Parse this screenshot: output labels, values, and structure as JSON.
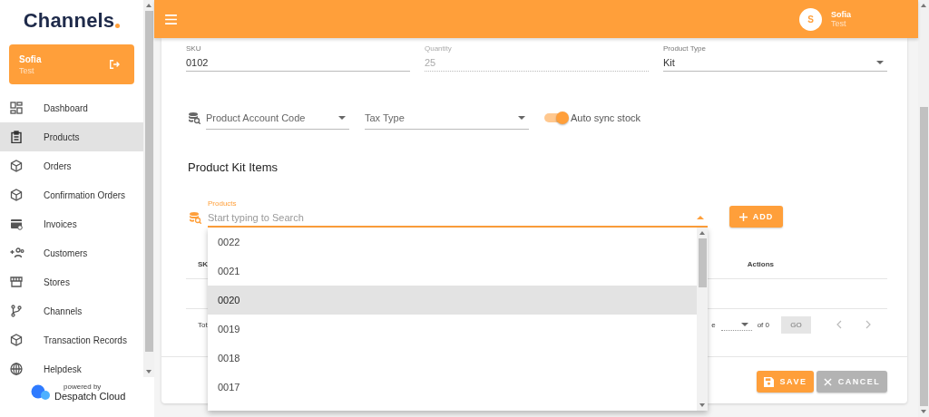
{
  "sidebar": {
    "logo": "Channels",
    "user": {
      "name": "Sofia",
      "role": "Test"
    },
    "items": [
      {
        "label": "Dashboard",
        "selected": false
      },
      {
        "label": "Products",
        "selected": true
      },
      {
        "label": "Orders",
        "selected": false
      },
      {
        "label": "Confirmation Orders",
        "selected": false
      },
      {
        "label": "Invoices",
        "selected": false
      },
      {
        "label": "Customers",
        "selected": false
      },
      {
        "label": "Stores",
        "selected": false
      },
      {
        "label": "Channels",
        "selected": false
      },
      {
        "label": "Transaction Records",
        "selected": false
      },
      {
        "label": "Helpdesk",
        "selected": false
      }
    ],
    "footer": {
      "caption": "powered by",
      "brand": "Despatch Cloud"
    }
  },
  "topbar": {
    "avatar": "S",
    "name": "Sofia",
    "role": "Test"
  },
  "form": {
    "fields": [
      {
        "label": "SKU",
        "value": "0102",
        "disabled": false,
        "kind": "text"
      },
      {
        "label": "Quantity",
        "value": "25",
        "disabled": true,
        "kind": "text"
      },
      {
        "label": "Product Type",
        "value": "Kit",
        "disabled": false,
        "kind": "select"
      }
    ],
    "selects": [
      {
        "placeholder": "Product Account Code"
      },
      {
        "placeholder": "Tax Type"
      }
    ],
    "toggle": {
      "label": "Auto sync stock",
      "on": true
    }
  },
  "kit": {
    "heading": "Product Kit Items",
    "search": {
      "label": "Products",
      "placeholder": "Start typing to Search",
      "expanded": true
    },
    "add_button": "ADD",
    "table": {
      "columns": [
        "SK",
        "Actions"
      ],
      "footer": {
        "total": "Tot",
        "page": "e",
        "of": "of 0",
        "go": "GO"
      }
    },
    "options": [
      {
        "label": "0022",
        "selected": false
      },
      {
        "label": "0021",
        "selected": false
      },
      {
        "label": "0020",
        "selected": true
      },
      {
        "label": "0019",
        "selected": false
      },
      {
        "label": "0018",
        "selected": false
      },
      {
        "label": "0017",
        "selected": false
      }
    ]
  },
  "actions": {
    "save": "SAVE",
    "cancel": "CANCEL"
  }
}
